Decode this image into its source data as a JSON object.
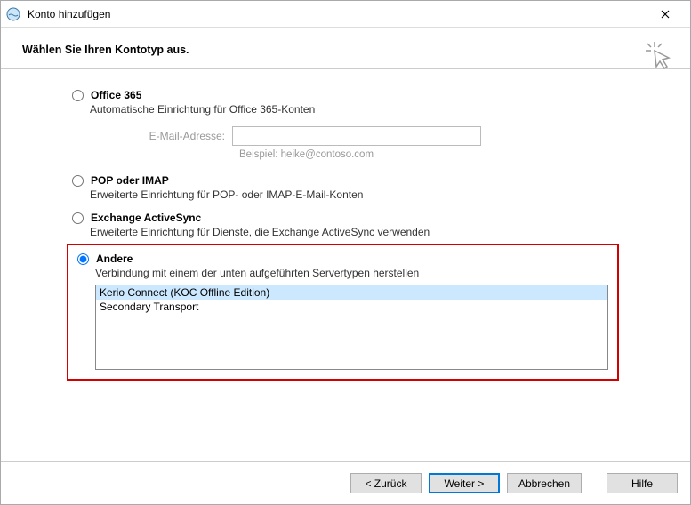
{
  "window": {
    "title": "Konto hinzufügen"
  },
  "header": {
    "title": "Wählen Sie Ihren Kontotyp aus."
  },
  "options": {
    "office365": {
      "label": "Office 365",
      "desc": "Automatische Einrichtung für Office 365-Konten",
      "emailLabel": "E-Mail-Adresse:",
      "emailPlaceholder": "",
      "emailExample": "Beispiel: heike@contoso.com"
    },
    "pop": {
      "label": "POP oder IMAP",
      "desc": "Erweiterte Einrichtung für POP- oder IMAP-E-Mail-Konten"
    },
    "eas": {
      "label": "Exchange ActiveSync",
      "desc": "Erweiterte Einrichtung für Dienste, die Exchange ActiveSync verwenden"
    },
    "other": {
      "label": "Andere",
      "desc": "Verbindung mit einem der unten aufgeführten Servertypen herstellen",
      "items": [
        "Kerio Connect (KOC Offline Edition)",
        "Secondary Transport"
      ],
      "selectedIndex": 0
    }
  },
  "buttons": {
    "back": "< Zurück",
    "next": "Weiter >",
    "cancel": "Abbrechen",
    "help": "Hilfe"
  }
}
